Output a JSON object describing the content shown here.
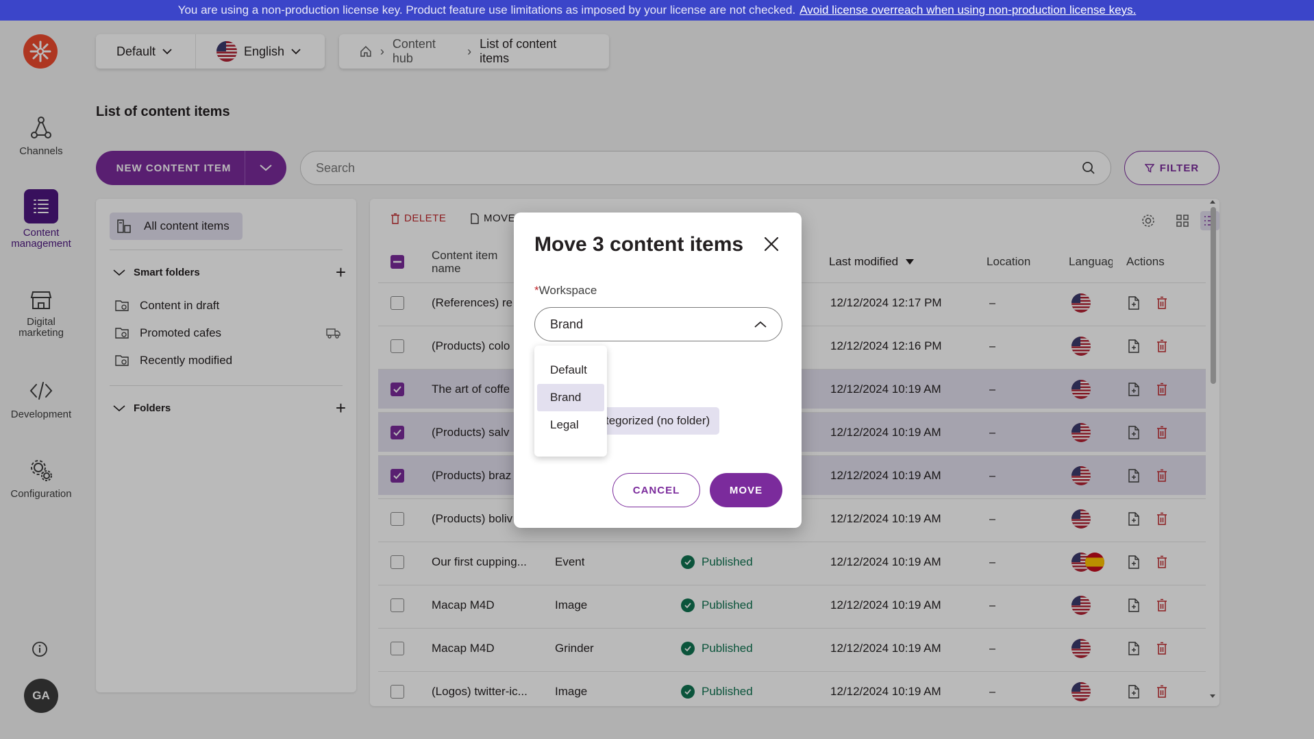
{
  "banner": {
    "text": "You are using a non-production license key. Product feature use limitations as imposed by your license are not checked.",
    "link": "Avoid license overreach when using non-production license keys."
  },
  "sidebar": {
    "items": [
      {
        "label": "Channels",
        "icon": "channels-icon"
      },
      {
        "label": "Content management",
        "icon": "content-management-icon",
        "active": true
      },
      {
        "label": "Digital marketing",
        "icon": "store-icon"
      },
      {
        "label": "Development",
        "icon": "code-icon"
      },
      {
        "label": "Configuration",
        "icon": "gears-icon"
      }
    ],
    "avatar": "GA"
  },
  "topbar": {
    "channel": "Default",
    "language": "English",
    "breadcrumbs": [
      "Content hub",
      "List of content items"
    ]
  },
  "page": {
    "title": "List of content items",
    "new_button": "NEW CONTENT ITEM",
    "search_placeholder": "Search",
    "filter_button": "FILTER"
  },
  "folders": {
    "all_items": "All content items",
    "smart_folders_label": "Smart folders",
    "smart_folders": [
      "Content in draft",
      "Promoted cafes",
      "Recently modified"
    ],
    "folders_label": "Folders"
  },
  "toolbar": {
    "delete": "DELETE",
    "move": "MOVE"
  },
  "table": {
    "columns": [
      "Content item name",
      "Last modified",
      "Location",
      "Languag",
      "Actions"
    ],
    "rows": [
      {
        "name": "(References) re",
        "type": "",
        "status": "",
        "modified": "12/12/2024 12:17 PM",
        "location": "–",
        "selected": false
      },
      {
        "name": "(Products) colo",
        "type": "",
        "status": "",
        "modified": "12/12/2024 12:16 PM",
        "location": "–",
        "selected": false
      },
      {
        "name": "The art of coffe",
        "type": "",
        "status": "",
        "modified": "12/12/2024 10:19 AM",
        "location": "–",
        "selected": true
      },
      {
        "name": "(Products) salv",
        "type": "",
        "status": "",
        "modified": "12/12/2024 10:19 AM",
        "location": "–",
        "selected": true
      },
      {
        "name": "(Products) braz",
        "type": "",
        "status": "",
        "modified": "12/12/2024 10:19 AM",
        "location": "–",
        "selected": true
      },
      {
        "name": "(Products) boliv",
        "type": "",
        "status": "",
        "modified": "12/12/2024 10:19 AM",
        "location": "–",
        "selected": false
      },
      {
        "name": "Our first cupping...",
        "type": "Event",
        "status": "Published",
        "modified": "12/12/2024 10:19 AM",
        "location": "–",
        "selected": false,
        "extra_flag": true
      },
      {
        "name": "Macap M4D",
        "type": "Image",
        "status": "Published",
        "modified": "12/12/2024 10:19 AM",
        "location": "–",
        "selected": false
      },
      {
        "name": "Macap M4D",
        "type": "Grinder",
        "status": "Published",
        "modified": "12/12/2024 10:19 AM",
        "location": "–",
        "selected": false
      },
      {
        "name": "(Logos) twitter-ic...",
        "type": "Image",
        "status": "Published",
        "modified": "12/12/2024 10:19 AM",
        "location": "–",
        "selected": false
      }
    ]
  },
  "modal": {
    "title": "Move 3 content items",
    "workspace_label": "Workspace",
    "workspace_value": "Brand",
    "workspace_options": [
      "Default",
      "Brand",
      "Legal"
    ],
    "folder_chip": "tegorized (no folder)",
    "cancel": "CANCEL",
    "move": "MOVE"
  },
  "colors": {
    "accent": "#7b2b9c",
    "banner": "#3b45c9",
    "published": "#107452",
    "danger": "#c0282d",
    "selection": "#e3e0ef"
  }
}
